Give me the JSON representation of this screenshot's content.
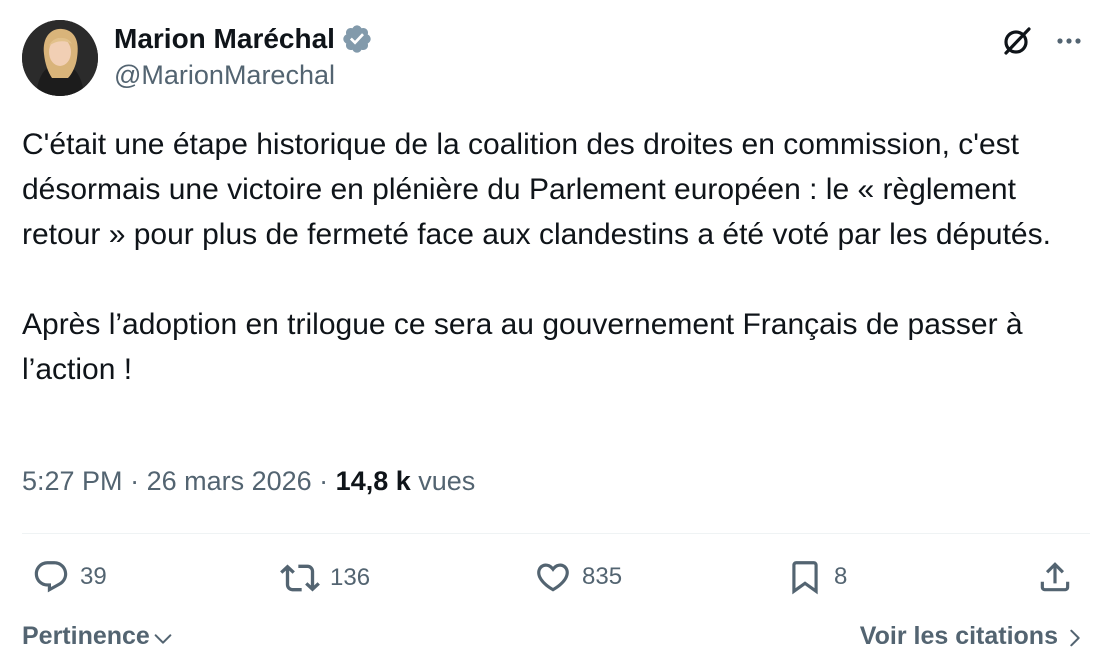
{
  "author": {
    "display_name": "Marion Maréchal",
    "handle": "@MarionMarechal",
    "verified": true
  },
  "tweet": {
    "paragraphs": [
      "C'était une étape historique de la coalition des droites en commission, c'est désormais une victoire en plénière du Parlement européen : le « règlement retour » pour plus de fermeté face aux clandestins a été voté par les députés.",
      "Après l’adoption en trilogue ce sera au gouvernement Français de passer à l’action !"
    ],
    "time": "5:27 PM",
    "date": "26 mars 2026",
    "views_count": "14,8 k",
    "views_label": "vues"
  },
  "actions": {
    "replies": "39",
    "reposts": "136",
    "likes": "835",
    "bookmarks": "8"
  },
  "footer": {
    "sort_label": "Pertinence",
    "quotes_label": "Voir les citations"
  },
  "icons": {
    "top": [
      "grok-icon",
      "more-icon"
    ],
    "actions": [
      "reply-icon",
      "repost-icon",
      "like-icon",
      "bookmark-icon",
      "share-icon"
    ],
    "footer": [
      "chevron-down-icon",
      "chevron-right-icon"
    ]
  },
  "colors": {
    "text_primary": "#0f1419",
    "text_secondary": "#536471",
    "verified": "#829aab",
    "divider": "#eff3f4"
  }
}
